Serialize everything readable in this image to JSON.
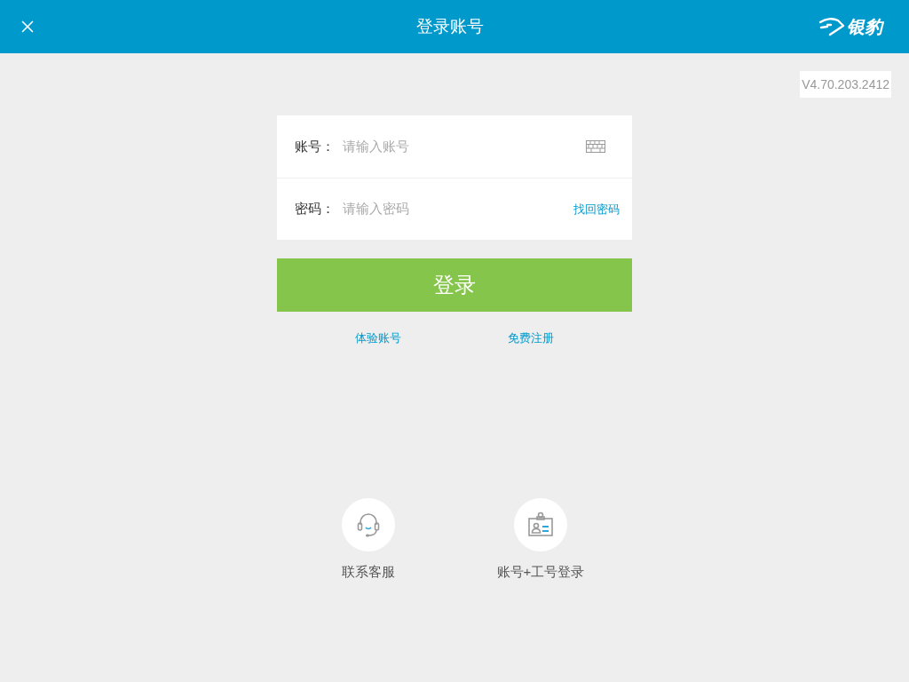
{
  "header": {
    "title": "登录账号",
    "logo": "银豹"
  },
  "version": "V4.70.203.2412",
  "form": {
    "fields": [
      {
        "kind": "account",
        "label": "账号：",
        "placeholder": "请输入账号"
      },
      {
        "kind": "password",
        "label": "密码：",
        "placeholder": "请输入密码",
        "link": "找回密码"
      }
    ],
    "submit": "登录"
  },
  "links": [
    "体验账号",
    "免费注册"
  ],
  "shortcuts": [
    {
      "kind": "support",
      "label": "联系客服"
    },
    {
      "kind": "badge",
      "label": "账号+工号登录"
    }
  ]
}
